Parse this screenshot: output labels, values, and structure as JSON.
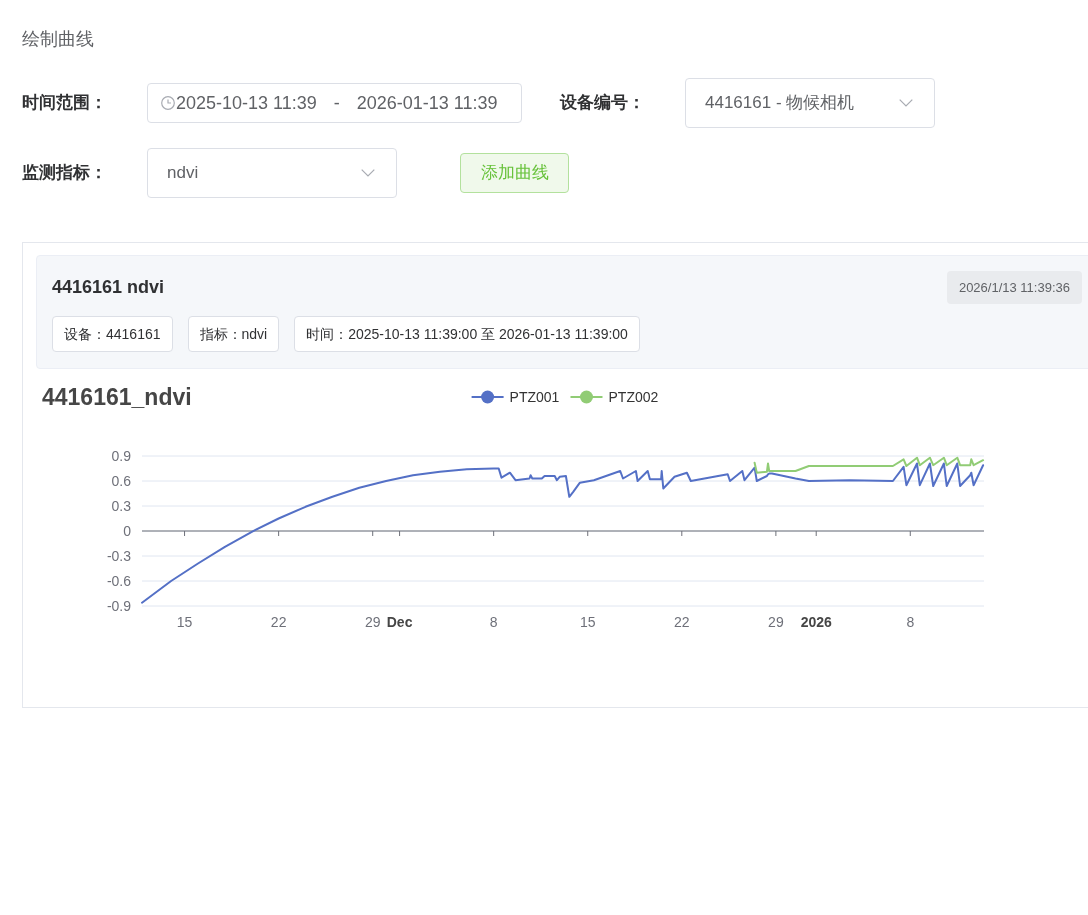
{
  "page_title": "绘制曲线",
  "form": {
    "rows": [
      [
        {
          "kind": "daterange",
          "label": "时间范围：",
          "start": "2025-10-13 11:39",
          "separator": "-",
          "end": "2026-01-13 11:39"
        },
        {
          "kind": "select",
          "label": "设备编号：",
          "value": "4416161 - 物候相机"
        }
      ],
      [
        {
          "kind": "select",
          "label": "监测指标：",
          "value": "ndvi"
        },
        {
          "kind": "button",
          "label": "添加曲线"
        }
      ]
    ]
  },
  "curve_card": {
    "title": "4416161 ndvi",
    "timestamp": "2026/1/13 11:39:36",
    "tags": [
      "设备：4416161",
      "指标：ndvi",
      "时间：2025-10-13 11:39:00 至 2026-01-13 11:39:00"
    ],
    "chart_data": {
      "type": "line",
      "title": "4416161_ndvi",
      "legend": "top",
      "grid": true,
      "x": [
        "2025-11-11 20:00",
        "2025-11-14 00:00",
        "2025-11-16 00:00",
        "2025-11-18 00:00",
        "2025-11-20 00:00",
        "2025-11-22 00:00",
        "2025-11-24 00:00",
        "2025-11-26 00:00",
        "2025-11-28 00:00",
        "2025-11-30 00:00",
        "2025-12-02 00:00",
        "2025-12-04 00:00",
        "2025-12-06 00:00",
        "2025-12-08 00:00",
        "2025-12-08 09:00",
        "2025-12-08 14:00",
        "2025-12-09 05:00",
        "2025-12-09 15:00",
        "2025-12-10 16:00",
        "2025-12-10 18:00",
        "2025-12-10 21:00",
        "2025-12-11 14:00",
        "2025-12-11 19:00",
        "2025-12-12 13:00",
        "2025-12-12 17:00",
        "2025-12-12 22:00",
        "2025-12-13 09:00",
        "2025-12-13 15:00",
        "2025-12-13 22:00",
        "2025-12-14 10:00",
        "2025-12-15 11:00",
        "2025-12-17 10:00",
        "2025-12-17 15:00",
        "2025-12-18 14:00",
        "2025-12-18 17:00",
        "2025-12-19 11:00",
        "2025-12-19 15:00",
        "2025-12-20 11:00",
        "2025-12-20 12:00",
        "2025-12-20 15:00",
        "2025-12-21 11:00",
        "2025-12-22 09:00",
        "2025-12-22 16:00",
        "2025-12-25 10:00",
        "2025-12-25 14:00",
        "2025-12-26 12:00",
        "2025-12-26 16:00",
        "2025-12-27 10:00",
        "2025-12-27 14:00",
        "2025-12-28 08:00",
        "2025-12-28 10:00",
        "2025-12-28 12:00",
        "2025-12-28 17:00",
        "2025-12-30 11:00",
        "2025-12-31 11:00",
        "2026-01-03 12:00",
        "2026-01-06 17:00",
        "2026-01-07 12:00",
        "2026-01-07 17:00",
        "2026-01-08 12:00",
        "2026-01-08 17:00",
        "2026-01-09 11:00",
        "2026-01-09 17:00",
        "2026-01-10 12:00",
        "2026-01-10 17:00",
        "2026-01-11 12:00",
        "2026-01-11 17:00",
        "2026-01-12 11:00",
        "2026-01-12 13:00",
        "2026-01-12 17:00",
        "2026-01-13 10:00"
      ],
      "series": [
        {
          "name": "PTZ001",
          "color": "#5470c6",
          "values": [
            -0.86,
            -0.6,
            -0.39,
            -0.19,
            -0.01,
            0.15,
            0.29,
            0.41,
            0.52,
            0.6,
            0.67,
            0.71,
            0.74,
            0.75,
            0.75,
            0.64,
            0.7,
            0.61,
            0.63,
            0.67,
            0.63,
            0.63,
            0.66,
            0.66,
            0.61,
            0.65,
            0.66,
            0.41,
            0.47,
            0.58,
            0.61,
            0.72,
            0.63,
            0.72,
            0.6,
            0.72,
            0.62,
            0.62,
            0.72,
            0.51,
            0.65,
            0.7,
            0.6,
            0.68,
            0.6,
            0.72,
            0.61,
            0.76,
            0.6,
            0.66,
            0.68,
            0.69,
            0.69,
            0.63,
            0.6,
            0.61,
            0.6,
            0.77,
            0.55,
            0.81,
            0.55,
            0.81,
            0.54,
            0.81,
            0.54,
            0.81,
            0.54,
            0.67,
            0.7,
            0.55,
            0.79
          ]
        },
        {
          "name": "PTZ002",
          "color": "#91cc75",
          "values": [
            null,
            null,
            null,
            null,
            null,
            null,
            null,
            null,
            null,
            null,
            null,
            null,
            null,
            null,
            null,
            null,
            null,
            null,
            null,
            null,
            null,
            null,
            null,
            null,
            null,
            null,
            null,
            null,
            null,
            null,
            null,
            null,
            null,
            null,
            null,
            null,
            null,
            null,
            null,
            null,
            null,
            null,
            null,
            null,
            null,
            null,
            null,
            0.82,
            0.7,
            0.71,
            0.81,
            0.72,
            0.72,
            0.72,
            0.78,
            0.78,
            0.78,
            0.86,
            0.78,
            0.88,
            0.79,
            0.88,
            0.79,
            0.88,
            0.79,
            0.88,
            0.79,
            0.79,
            0.86,
            0.79,
            0.85
          ]
        }
      ],
      "xlim": [
        "2025-11-11 20:00",
        "2026-01-13 11:39"
      ],
      "ylim": [
        -0.9,
        0.9
      ],
      "xticks": [
        {
          "value": "2025-11-15",
          "label": "15"
        },
        {
          "value": "2025-11-22",
          "label": "22"
        },
        {
          "value": "2025-11-29",
          "label": "29"
        },
        {
          "value": "2025-12-01",
          "label": "Dec"
        },
        {
          "value": "2025-12-08",
          "label": "8"
        },
        {
          "value": "2025-12-15",
          "label": "15"
        },
        {
          "value": "2025-12-22",
          "label": "22"
        },
        {
          "value": "2025-12-29",
          "label": "29"
        },
        {
          "value": "2026-01-01",
          "label": "2026"
        },
        {
          "value": "2026-01-08",
          "label": "8"
        }
      ],
      "yticks": [
        -0.9,
        -0.6,
        -0.3,
        0,
        0.3,
        0.6,
        0.9
      ]
    }
  }
}
